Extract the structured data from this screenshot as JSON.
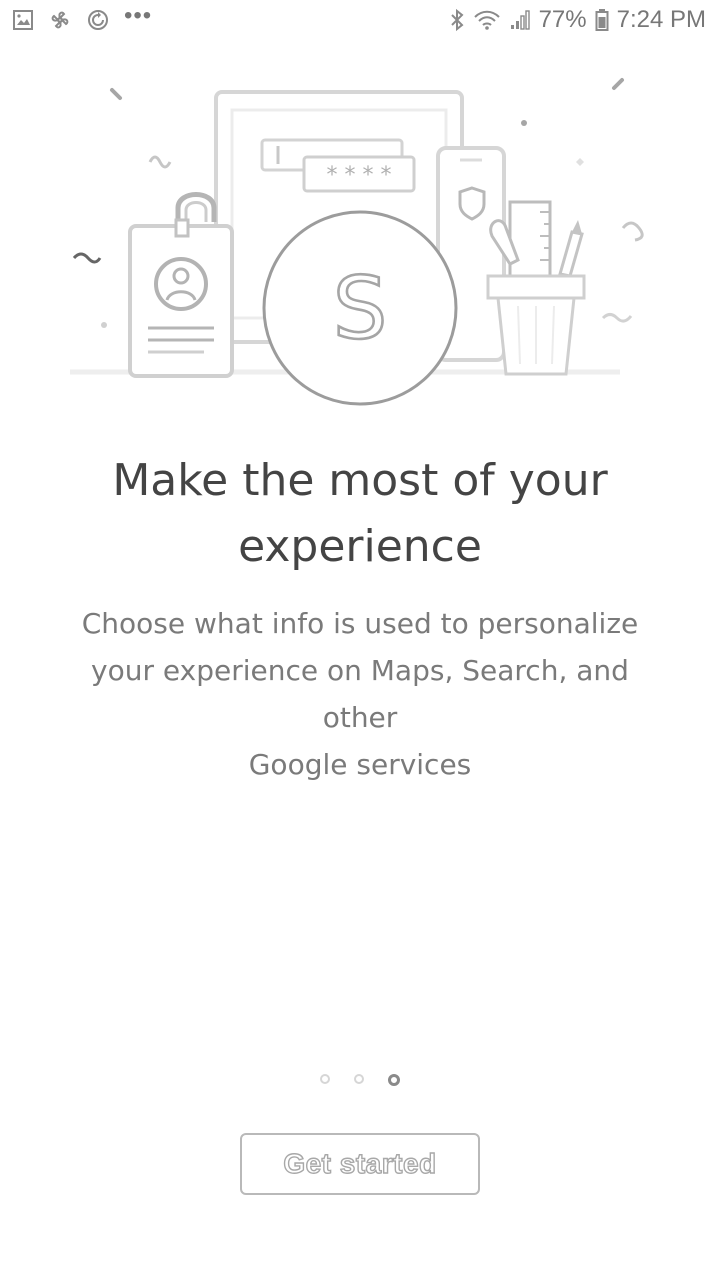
{
  "status_bar": {
    "battery_percent": "77%",
    "time": "7:24 PM",
    "overflow": "•••",
    "icons_left": [
      "gallery-icon",
      "pinwheel-icon",
      "sync-icon"
    ],
    "icons_right": [
      "bluetooth-icon",
      "wifi-icon",
      "signal-icon",
      "battery-icon"
    ]
  },
  "illustration": {
    "avatar_letter": "S",
    "password_mask": "* * * *"
  },
  "onboarding": {
    "headline_line1": "Make the most of your",
    "headline_line2": "experience",
    "subtext_line1": "Choose what info is used to personalize",
    "subtext_line2": "your experience on Maps, Search, and other",
    "subtext_line3": "Google services"
  },
  "pager": {
    "total": 3,
    "active_index": 2
  },
  "actions": {
    "get_started_label": "Get started"
  },
  "colors": {
    "line": "#cfcfcf",
    "line_dark": "#b5b5b5",
    "text_dark": "#444444",
    "text_muted": "#7a7a7a"
  }
}
